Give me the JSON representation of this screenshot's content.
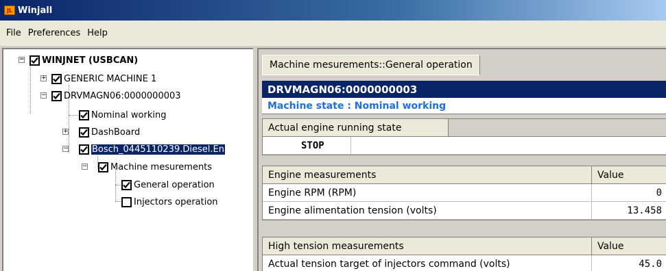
{
  "window": {
    "title": "Winjall",
    "icon": "winjall-app-icon"
  },
  "menubar": {
    "items": [
      "File",
      "Preferences",
      "Help"
    ]
  },
  "tree": {
    "nodes": [
      {
        "label": "WINJNET (USBCAN)",
        "checked": true,
        "expander": "minus",
        "bold": true
      },
      {
        "label": "GENERIC MACHINE 1",
        "checked": true,
        "expander": "plus"
      },
      {
        "label": "DRVMAGN06:0000000003",
        "checked": true,
        "expander": "minus"
      },
      {
        "label": "Nominal working",
        "checked": true,
        "expander": "none"
      },
      {
        "label": "DashBoard",
        "checked": true,
        "expander": "plus"
      },
      {
        "label": "Bosch_0445110239.Diesel.En",
        "checked": true,
        "expander": "minus",
        "selected": true
      },
      {
        "label": "Machine mesurements",
        "checked": true,
        "expander": "minus"
      },
      {
        "label": "General operation",
        "checked": true,
        "expander": "none"
      },
      {
        "label": "Injectors operation",
        "checked": false,
        "expander": "none"
      }
    ]
  },
  "panel": {
    "tab_label": "Machine mesurements::General operation",
    "machine_header": "DRVMAGN06:0000000003",
    "machine_state": "Machine state : Nominal working",
    "running_state": {
      "header": "Actual engine running state",
      "value": "STOP"
    },
    "engine_measurements": {
      "header": "Engine measurements",
      "value_header": "Value",
      "rows": [
        {
          "label": "Engine RPM (RPM)",
          "value": "0"
        },
        {
          "label": "Engine alimentation tension (volts)",
          "value": "13.458"
        }
      ]
    },
    "high_tension_measurements": {
      "header": "High tension measurements",
      "value_header": "Value",
      "rows": [
        {
          "label": "Actual tension target of injectors command (volts)",
          "value": "45.0"
        }
      ]
    }
  },
  "colors": {
    "title_bar": "#0a246a",
    "machine_state_text": "#1e6fe0",
    "selection": "#0a246a"
  }
}
